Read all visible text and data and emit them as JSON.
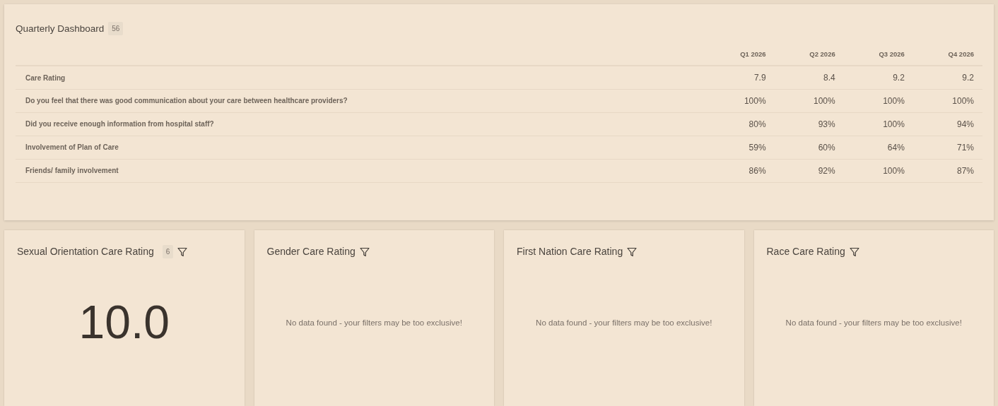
{
  "dashboard": {
    "title": "Quarterly Dashboard",
    "count": "56",
    "table": {
      "columns": [
        "Q1 2026",
        "Q2 2026",
        "Q3 2026",
        "Q4 2026"
      ],
      "rows": [
        {
          "label": "Care Rating",
          "values": [
            "7.9",
            "8.4",
            "9.2",
            "9.2"
          ]
        },
        {
          "label": "Do you feel that there was good communication about your care between healthcare providers?",
          "values": [
            "100%",
            "100%",
            "100%",
            "100%"
          ]
        },
        {
          "label": "Did you receive enough information from hospital staff?",
          "values": [
            "80%",
            "93%",
            "100%",
            "94%"
          ]
        },
        {
          "label": "Involvement of Plan of Care",
          "values": [
            "59%",
            "60%",
            "64%",
            "71%"
          ]
        },
        {
          "label": "Friends/ family involvement",
          "values": [
            "86%",
            "92%",
            "100%",
            "87%"
          ]
        }
      ]
    }
  },
  "cards": [
    {
      "title": "Sexual Orientation Care Rating",
      "count": "6",
      "kind": "value",
      "value": "10.0"
    },
    {
      "title": "Gender Care Rating",
      "kind": "empty",
      "message": "No data found - your filters may be too exclusive!"
    },
    {
      "title": "First Nation Care Rating",
      "kind": "empty",
      "message": "No data found - your filters may be too exclusive!"
    },
    {
      "title": "Race Care Rating",
      "kind": "empty",
      "message": "No data found - your filters may be too exclusive!"
    }
  ]
}
